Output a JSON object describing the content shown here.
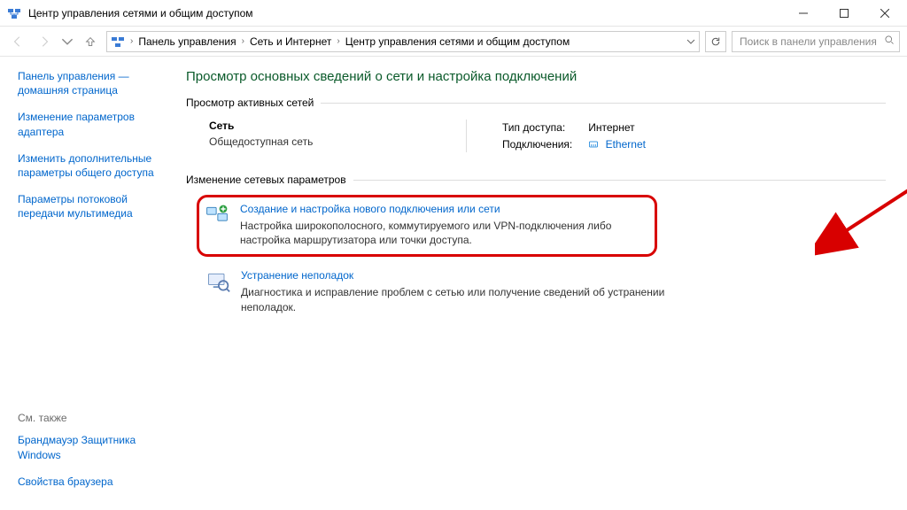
{
  "window": {
    "title": "Центр управления сетями и общим доступом"
  },
  "breadcrumb": {
    "items": [
      "Панель управления",
      "Сеть и Интернет",
      "Центр управления сетями и общим доступом"
    ]
  },
  "search": {
    "placeholder": "Поиск в панели управления"
  },
  "sidebar": {
    "links": [
      "Панель управления — домашняя страница",
      "Изменение параметров адаптера",
      "Изменить дополнительные параметры общего доступа",
      "Параметры потоковой передачи мультимедиа"
    ],
    "see_also_label": "См. также",
    "see_also": [
      "Брандмауэр Защитника Windows",
      "Свойства браузера"
    ]
  },
  "main": {
    "page_title": "Просмотр основных сведений о сети и настройка подключений",
    "active_networks_label": "Просмотр активных сетей",
    "network": {
      "name": "Сеть",
      "profile": "Общедоступная сеть",
      "access_label": "Тип доступа:",
      "access_value": "Интернет",
      "connections_label": "Подключения:",
      "connections_value": "Ethernet"
    },
    "change_settings_label": "Изменение сетевых параметров",
    "tasks": [
      {
        "title": "Создание и настройка нового подключения или сети",
        "desc": "Настройка широкополосного, коммутируемого или VPN-подключения либо настройка маршрутизатора или точки доступа."
      },
      {
        "title": "Устранение неполадок",
        "desc": "Диагностика и исправление проблем с сетью или получение сведений об устранении неполадок."
      }
    ]
  }
}
